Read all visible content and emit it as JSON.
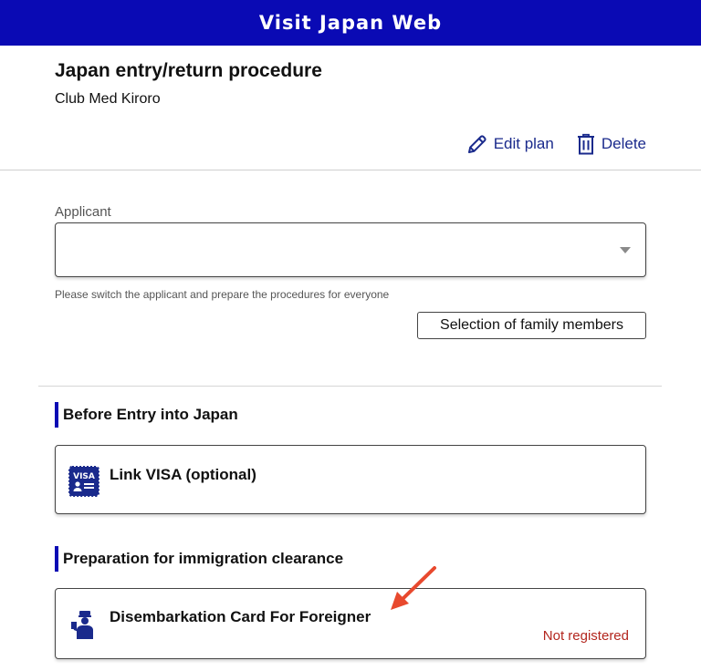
{
  "header": {
    "title": "Visit Japan Web"
  },
  "page": {
    "title": "Japan entry/return procedure",
    "plan_name": "Club Med Kiroro"
  },
  "actions": {
    "edit_label": "Edit plan",
    "delete_label": "Delete"
  },
  "applicant": {
    "label": "Applicant",
    "selected_value": "",
    "helper_text": "Please switch the applicant and prepare the procedures for everyone",
    "family_button_label": "Selection of family members"
  },
  "sections": [
    {
      "heading": "Before Entry into Japan",
      "card": {
        "title": "Link VISA (optional)",
        "icon": "visa-icon",
        "status": ""
      }
    },
    {
      "heading": "Preparation for immigration clearance",
      "card": {
        "title": "Disembarkation Card For Foreigner",
        "icon": "immigration-officer-icon",
        "status": "Not registered"
      }
    }
  ],
  "colors": {
    "header_bg": "#0a0ab4",
    "accent": "#1a2a8c",
    "status_error": "#b3261e",
    "annotation_arrow": "#e8492e"
  }
}
